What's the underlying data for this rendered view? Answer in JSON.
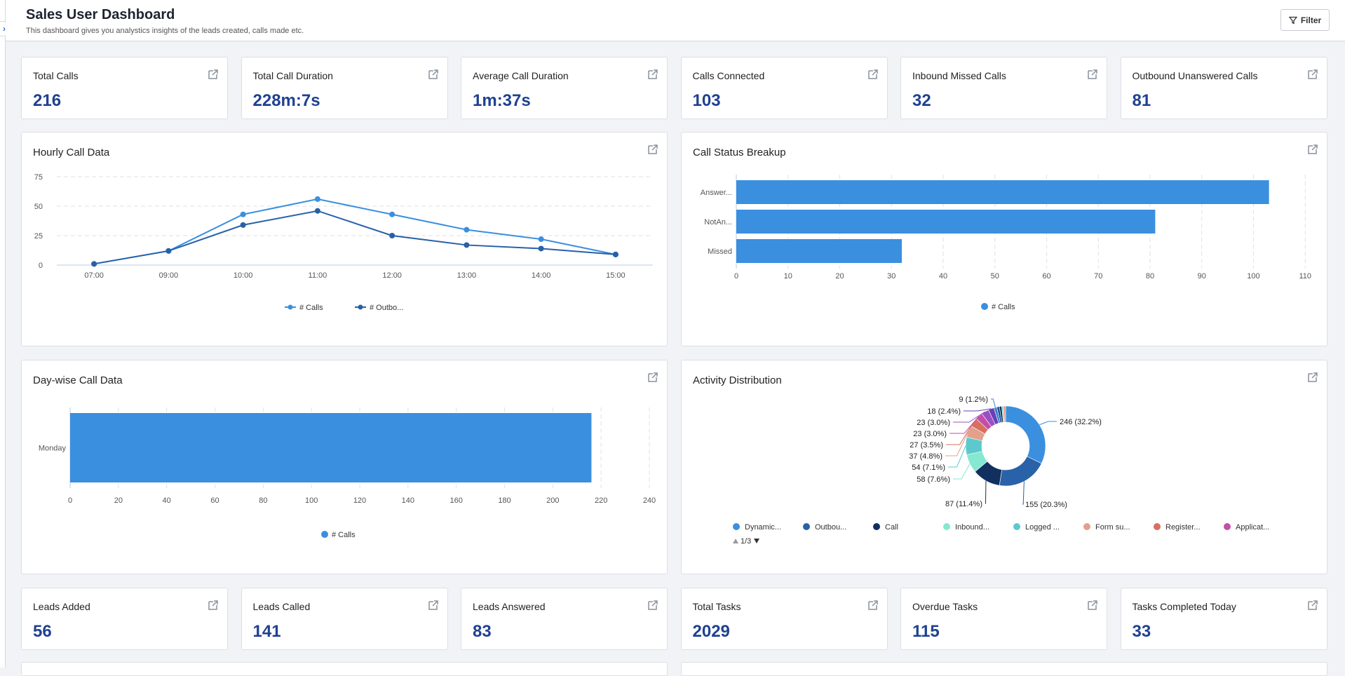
{
  "header": {
    "title": "Sales User Dashboard",
    "subtitle": "This dashboard gives you analystics insights of the leads created, calls made etc.",
    "filter_label": "Filter"
  },
  "kpis_top": [
    {
      "label": "Total Calls",
      "value": "216"
    },
    {
      "label": "Total Call Duration",
      "value": "228m:7s"
    },
    {
      "label": "Average Call Duration",
      "value": "1m:37s"
    },
    {
      "label": "Calls Connected",
      "value": "103"
    },
    {
      "label": "Inbound Missed Calls",
      "value": "32"
    },
    {
      "label": "Outbound Unanswered Calls",
      "value": "81"
    }
  ],
  "kpis_bottom": [
    {
      "label": "Leads Added",
      "value": "56"
    },
    {
      "label": "Leads Called",
      "value": "141"
    },
    {
      "label": "Leads Answered",
      "value": "83"
    },
    {
      "label": "Total Tasks",
      "value": "2029"
    },
    {
      "label": "Overdue Tasks",
      "value": "115"
    },
    {
      "label": "Tasks Completed Today",
      "value": "33"
    }
  ],
  "charts": {
    "hourly": "Hourly Call Data",
    "status": "Call Status Breakup",
    "daywise": "Day-wise Call Data",
    "activity": "Activity Distribution"
  },
  "chart_data": [
    {
      "type": "line",
      "title": "Hourly Call Data",
      "categories": [
        "07:00",
        "09:00",
        "10:00",
        "11:00",
        "12:00",
        "13:00",
        "14:00",
        "15:00"
      ],
      "ylim": [
        0,
        75
      ],
      "yticks": [
        0,
        25,
        50,
        75
      ],
      "grid": true,
      "legend": "bottom",
      "series": [
        {
          "name": "# Calls",
          "color": "#3a8fdf",
          "values": [
            1,
            12,
            43,
            56,
            43,
            30,
            22,
            9
          ]
        },
        {
          "name": "# Outbo...",
          "color": "#2860a8",
          "values": [
            1,
            12,
            34,
            46,
            25,
            17,
            14,
            9
          ]
        }
      ]
    },
    {
      "type": "bar",
      "orientation": "horizontal",
      "title": "Call Status Breakup",
      "categories": [
        "Answer...",
        "NotAn...",
        "Missed"
      ],
      "values": [
        103,
        81,
        32
      ],
      "xlim": [
        0,
        112
      ],
      "xticks": [
        0,
        10,
        20,
        30,
        40,
        50,
        60,
        70,
        80,
        90,
        100,
        110
      ],
      "grid": true,
      "legend": "bottom",
      "series": [
        {
          "name": "# Calls",
          "color": "#3a8fdf"
        }
      ]
    },
    {
      "type": "bar",
      "orientation": "horizontal",
      "title": "Day-wise Call Data",
      "categories": [
        "Monday"
      ],
      "values": [
        216
      ],
      "xlim": [
        0,
        240
      ],
      "xticks": [
        0,
        20,
        40,
        60,
        80,
        100,
        120,
        140,
        160,
        180,
        200,
        220,
        240
      ],
      "grid": true,
      "legend": "bottom",
      "series": [
        {
          "name": "# Calls",
          "color": "#3a8fdf"
        }
      ]
    },
    {
      "type": "pie",
      "donut": true,
      "title": "Activity Distribution",
      "legend": "bottom",
      "legend_page": "1/3",
      "slices": [
        {
          "name": "Dynamic...",
          "value": 246,
          "label": "246 (32.2%)",
          "color": "#3b8fdf"
        },
        {
          "name": "Outbou...",
          "value": 155,
          "label": "155 (20.3%)",
          "color": "#2962a8"
        },
        {
          "name": "Call",
          "value": 87,
          "label": "87 (11.4%)",
          "color": "#12305f"
        },
        {
          "name": "Inbound...",
          "value": 58,
          "label": "58 (7.6%)",
          "color": "#86e8d0"
        },
        {
          "name": "Logged ...",
          "value": 54,
          "label": "54 (7.1%)",
          "color": "#5cc9cc"
        },
        {
          "name": "Form su...",
          "value": 37,
          "label": "37 (4.8%)",
          "color": "#e3a08a"
        },
        {
          "name": "Register...",
          "value": 27,
          "label": "27 (3.5%)",
          "color": "#d8705f"
        },
        {
          "name": "Applicat...",
          "value": 23,
          "label": "23 (3.0%)",
          "color": "#c44ea9"
        },
        {
          "name": "",
          "value": 23,
          "label": "23 (3.0%)",
          "color": "#9b4fc4"
        },
        {
          "name": "",
          "value": 18,
          "label": "18 (2.4%)",
          "color": "#6a3fb5"
        },
        {
          "name": "",
          "value": 9,
          "label": "9 (1.2%)",
          "color": "#3a7fd0"
        },
        {
          "name": "",
          "value": 8,
          "label": "",
          "color": "#1d4f95"
        },
        {
          "name": "",
          "value": 7,
          "label": "",
          "color": "#0f2a55"
        },
        {
          "name": "",
          "value": 6,
          "label": "",
          "color": "#7fe0cc"
        },
        {
          "name": "",
          "value": 6,
          "label": "",
          "color": "#e88f7a"
        }
      ]
    }
  ]
}
